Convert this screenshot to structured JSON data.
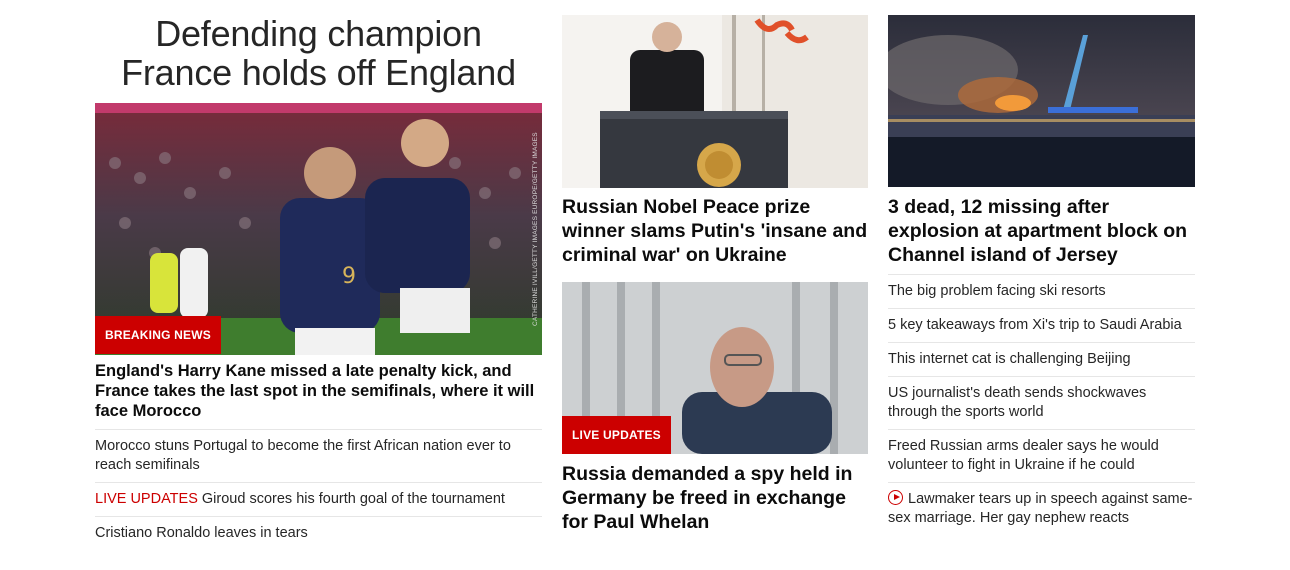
{
  "left": {
    "headline": "Defending champion France holds off England",
    "image_credit": "CATHERINE IVILL/GETTY IMAGES EUROPE/GETTY IMAGES",
    "badge": "BREAKING NEWS",
    "title": "England's Harry Kane missed a late penalty kick, and France takes the last spot in the semifinals, where it will face Morocco",
    "links": [
      {
        "tag": "",
        "text": "Morocco stuns Portugal to become the first African nation ever to reach semifinals"
      },
      {
        "tag": "LIVE UPDATES",
        "text": " Giroud scores his fourth goal of the tournament"
      },
      {
        "tag": "",
        "text": "Cristiano Ronaldo leaves in tears"
      }
    ]
  },
  "middle": {
    "story1": {
      "title": "Russian Nobel Peace prize winner slams Putin's 'insane and criminal war' on Ukraine"
    },
    "story2": {
      "badge": "LIVE UPDATES",
      "title": "Russia demanded a spy held in Germany be freed in exchange for Paul Whelan"
    }
  },
  "right": {
    "title": "3 dead, 12 missing after explosion at apartment block on Channel island of Jersey",
    "links": [
      {
        "text": "The big problem facing ski resorts"
      },
      {
        "text": "5 key takeaways from Xi's trip to Saudi Arabia"
      },
      {
        "text": "This internet cat is challenging Beijing"
      },
      {
        "text": "US journalist's death sends shockwaves through the sports world"
      },
      {
        "text": "Freed Russian arms dealer says he would volunteer to fight in Ukraine if he could"
      },
      {
        "text": "Lawmaker tears up in speech against same-sex marriage. Her gay nephew reacts",
        "icon": "play-circle-icon"
      }
    ]
  },
  "colors": {
    "accent": "#cc0000",
    "text": "#0c0c0c",
    "divider": "#e6e6e6"
  }
}
